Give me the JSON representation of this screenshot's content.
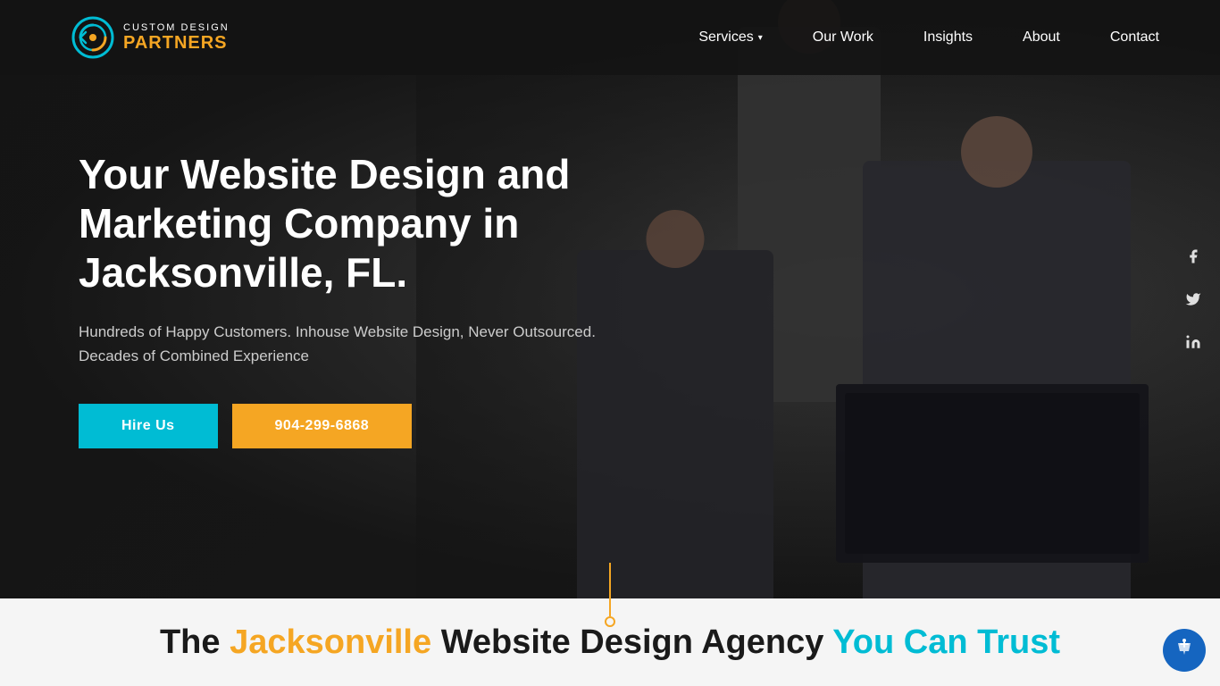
{
  "brand": {
    "name_top": "CUSTOM DESIGN",
    "name_bottom": "PARTNERS",
    "logo_icon_color": "#00bcd4",
    "logo_accent_color": "#f5a623"
  },
  "nav": {
    "items": [
      {
        "label": "Services",
        "has_dropdown": true
      },
      {
        "label": "Our Work",
        "has_dropdown": false
      },
      {
        "label": "Insights",
        "has_dropdown": false
      },
      {
        "label": "About",
        "has_dropdown": false
      },
      {
        "label": "Contact",
        "has_dropdown": false
      }
    ]
  },
  "hero": {
    "title": "Your Website Design and Marketing Company in Jacksonville, FL.",
    "subtitle": "Hundreds of Happy Customers. Inhouse Website Design, Never Outsourced. Decades of Combined Experience",
    "cta_hire": "Hire Us",
    "cta_phone": "904-299-6868"
  },
  "social": {
    "facebook": "f",
    "twitter": "t",
    "linkedin": "in"
  },
  "bottom": {
    "text_part1": "The ",
    "text_highlight": "Jacksonville",
    "text_part2": " Website Design Agency ",
    "text_highlight2": "You Can Trust"
  },
  "accessibility": {
    "label": "Accessibility"
  }
}
